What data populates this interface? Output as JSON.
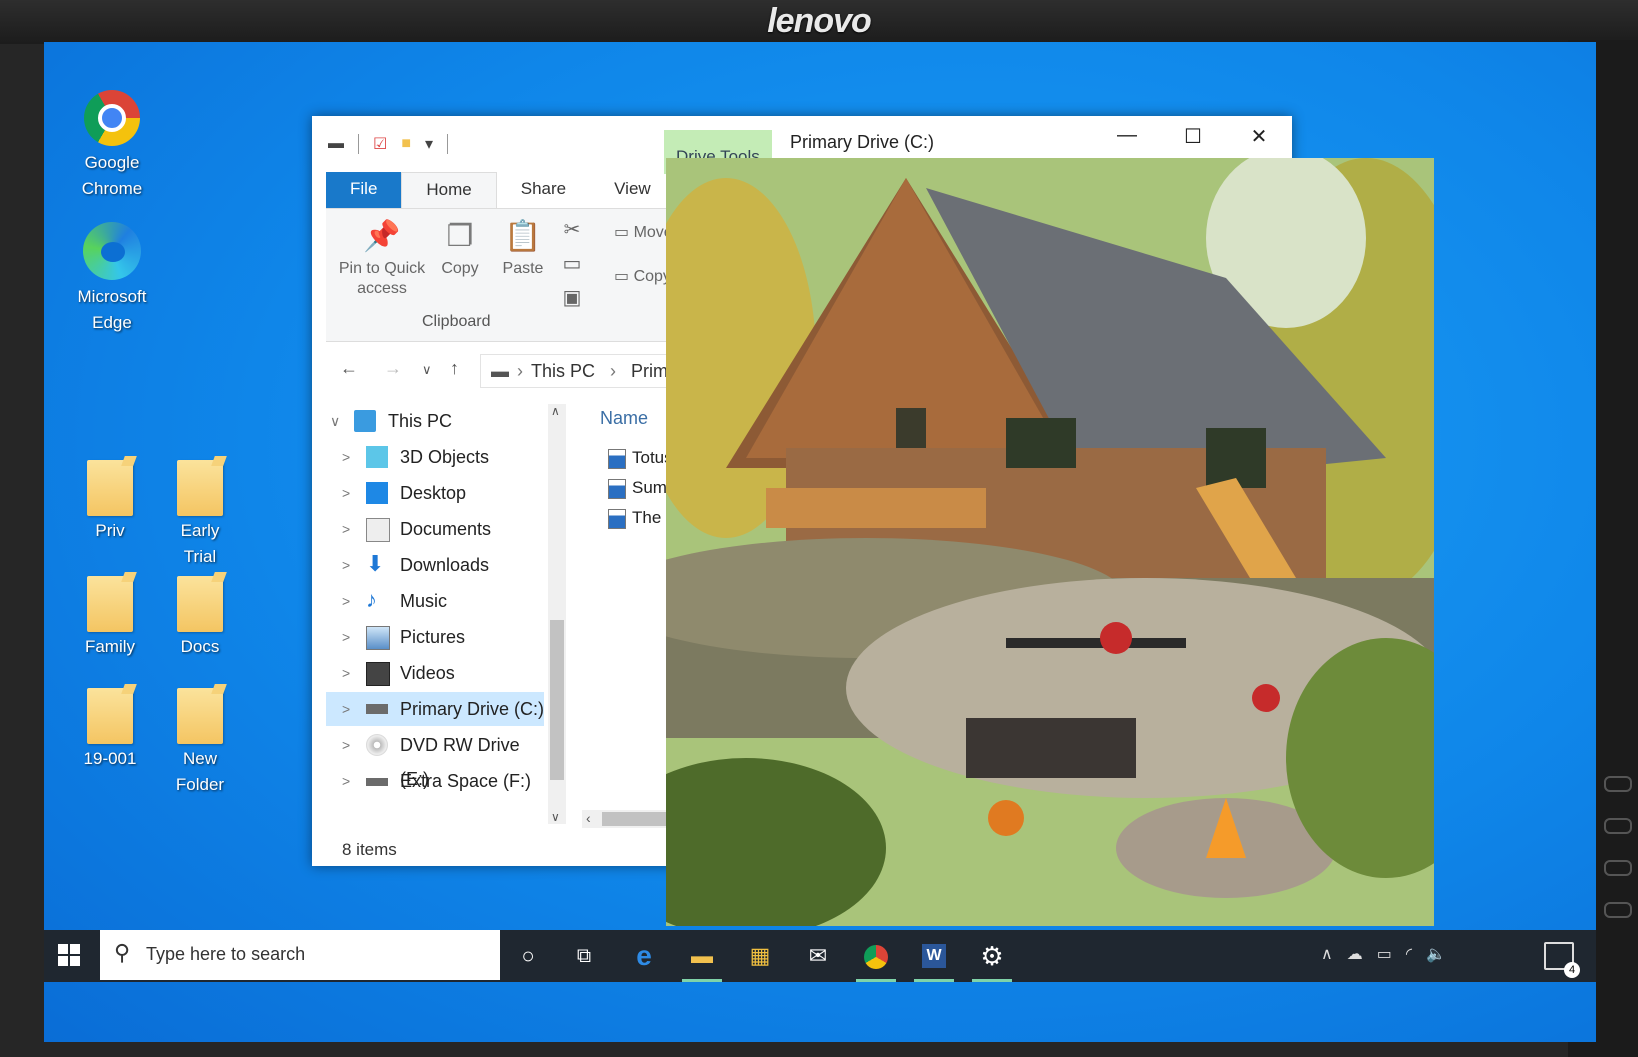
{
  "monitor": {
    "brand": "lenovo"
  },
  "desktop": {
    "icons": [
      {
        "label_lines": [
          "Google",
          "Chrome"
        ],
        "icon": "chrome-icon"
      },
      {
        "label_lines": [
          "Microsoft",
          "Edge"
        ],
        "icon": "edge-icon"
      },
      {
        "label_lines": [
          "Priv"
        ],
        "icon": "folder-icon"
      },
      {
        "label_lines": [
          "Early",
          "Trial"
        ],
        "icon": "folder-icon"
      },
      {
        "label_lines": [
          "Family"
        ],
        "icon": "folder-icon"
      },
      {
        "label_lines": [
          "Docs"
        ],
        "icon": "folder-icon"
      },
      {
        "label_lines": [
          "19-001"
        ],
        "icon": "folder-icon"
      },
      {
        "label_lines": [
          "New",
          "Folder"
        ],
        "icon": "folder-icon"
      }
    ]
  },
  "explorer": {
    "context_tab": "Drive Tools",
    "title": "Primary Drive (C:)",
    "window_buttons": {
      "minimize": "—",
      "maximize": "☐",
      "close": "✕"
    },
    "tabs": [
      "File",
      "Home",
      "Share",
      "View"
    ],
    "ribbon": {
      "pin": [
        "Pin to Quick",
        "access"
      ],
      "copy": "Copy",
      "paste": "Paste",
      "move": "Move",
      "copy_to": "Copy",
      "group_label": "Clipboard"
    },
    "address": {
      "segments": [
        "This PC",
        "Prima"
      ]
    },
    "tree": [
      {
        "label": "This PC",
        "icon": "pc-icon",
        "expanded": true
      },
      {
        "label": "3D Objects",
        "icon": "cube-icon"
      },
      {
        "label": "Desktop",
        "icon": "desktop-icon"
      },
      {
        "label": "Documents",
        "icon": "document-icon"
      },
      {
        "label": "Downloads",
        "icon": "download-arrow-icon"
      },
      {
        "label": "Music",
        "icon": "music-note-icon"
      },
      {
        "label": "Pictures",
        "icon": "picture-icon"
      },
      {
        "label": "Videos",
        "icon": "film-icon"
      },
      {
        "label": "Primary Drive (C:)",
        "icon": "drive-icon",
        "selected": true
      },
      {
        "label": "DVD RW Drive (E:)",
        "icon": "dvd-icon"
      },
      {
        "label": "Extra Space (F:)",
        "icon": "drive-icon"
      }
    ],
    "column_header": "Name",
    "files": [
      "Totus T",
      "Summe",
      "The Me"
    ],
    "status": "8 items"
  },
  "taskbar": {
    "search_placeholder": "Type here to search",
    "pinned": [
      "cortana-circle-icon",
      "task-view-icon",
      "edge-icon",
      "file-explorer-icon",
      "store-icon",
      "mail-icon",
      "chrome-icon",
      "word-icon",
      "settings-gear-icon"
    ],
    "notification_count": "4",
    "colors": {
      "taskbar": "#1f2730",
      "running_indicator": "#7fd3a9",
      "accent": "#1979ca",
      "drive_tools": "#c4ecb6"
    }
  }
}
